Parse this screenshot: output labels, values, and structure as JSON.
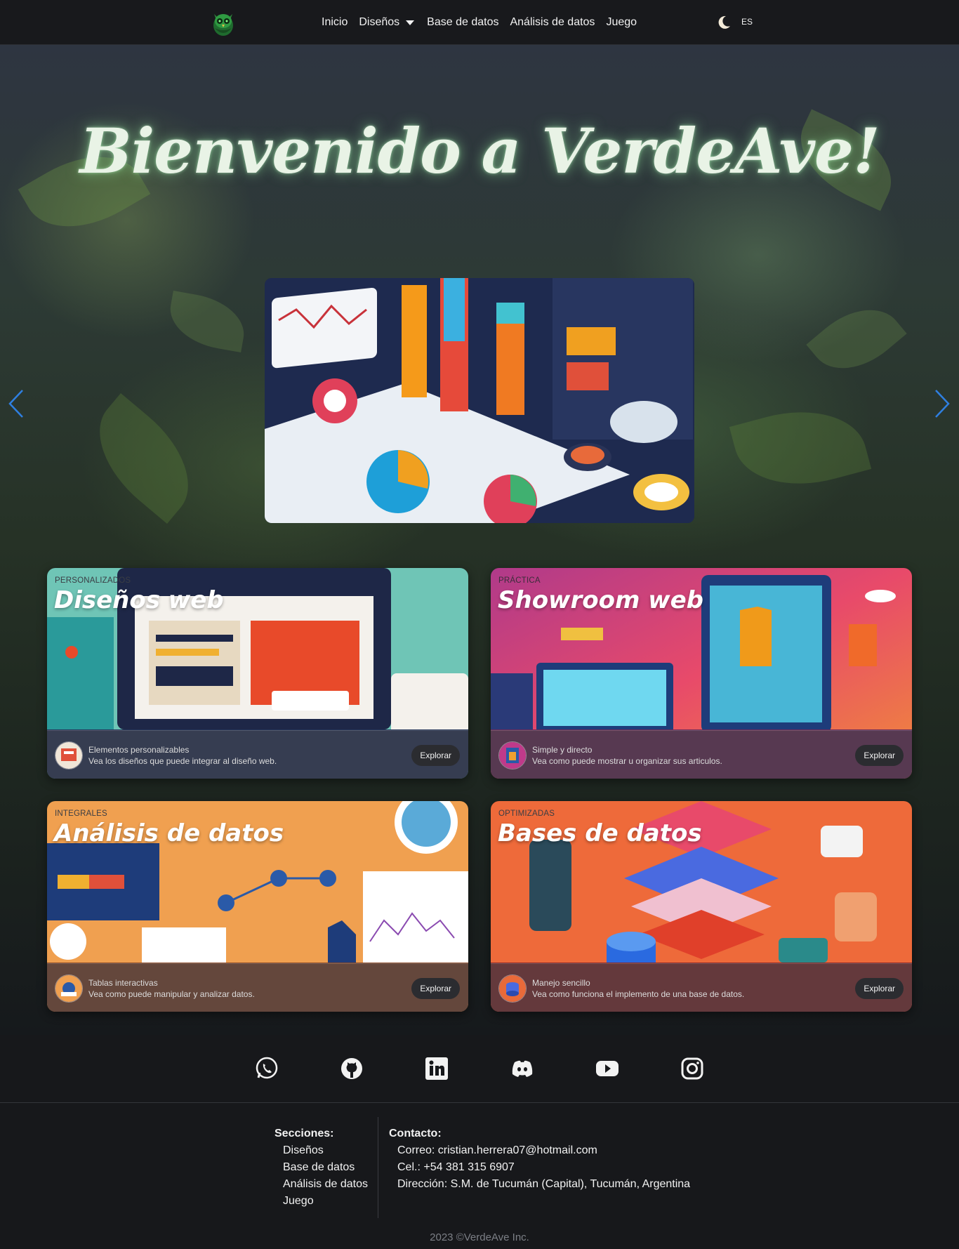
{
  "nav": {
    "logo_icon": "owl-logo-icon",
    "links": [
      "Inicio",
      "Diseños",
      "Base de datos",
      "Análisis de datos",
      "Juego"
    ],
    "theme_icon": "moon-icon",
    "language": "ES"
  },
  "hero": {
    "title": "Bienvenido a VerdeAve!"
  },
  "cards": [
    {
      "tag": "PERSONALIZADOS",
      "title": "Diseños web",
      "line1": "Elementos personalizables",
      "line2": "Vea los diseños que puede integrar al diseño web.",
      "button": "Explorar"
    },
    {
      "tag": "PRÁCTICA",
      "title": "Showroom web",
      "line1": "Simple y directo",
      "line2": "Vea como puede mostrar u organizar sus articulos.",
      "button": "Explorar"
    },
    {
      "tag": "INTEGRALES",
      "title": "Análisis de datos",
      "line1": "Tablas interactivas",
      "line2": "Vea como puede manipular y analizar datos.",
      "button": "Explorar"
    },
    {
      "tag": "OPTIMIZADAS",
      "title": "Bases de datos",
      "line1": "Manejo sencillo",
      "line2": "Vea como funciona el implemento de una base de datos.",
      "button": "Explorar"
    }
  ],
  "social": [
    "whatsapp-icon",
    "github-icon",
    "linkedin-icon",
    "discord-icon",
    "youtube-icon",
    "instagram-icon"
  ],
  "footer": {
    "sections_title": "Secciones:",
    "sections": [
      "Diseños",
      "Base de datos",
      "Análisis de datos",
      "Juego"
    ],
    "contact_title": "Contacto:",
    "contact": [
      "Correo: cristian.herrera07@hotmail.com",
      "Cel.: +54 381 315 6907",
      "Dirección: S.M. de Tucumán (Capital), Tucumán, Argentina"
    ],
    "copyright": "2023 ©VerdeAve Inc."
  },
  "colors": {
    "navbar": "#18191c",
    "accent_arrow": "#2f7fe0",
    "glow": "#a0ffaa"
  }
}
